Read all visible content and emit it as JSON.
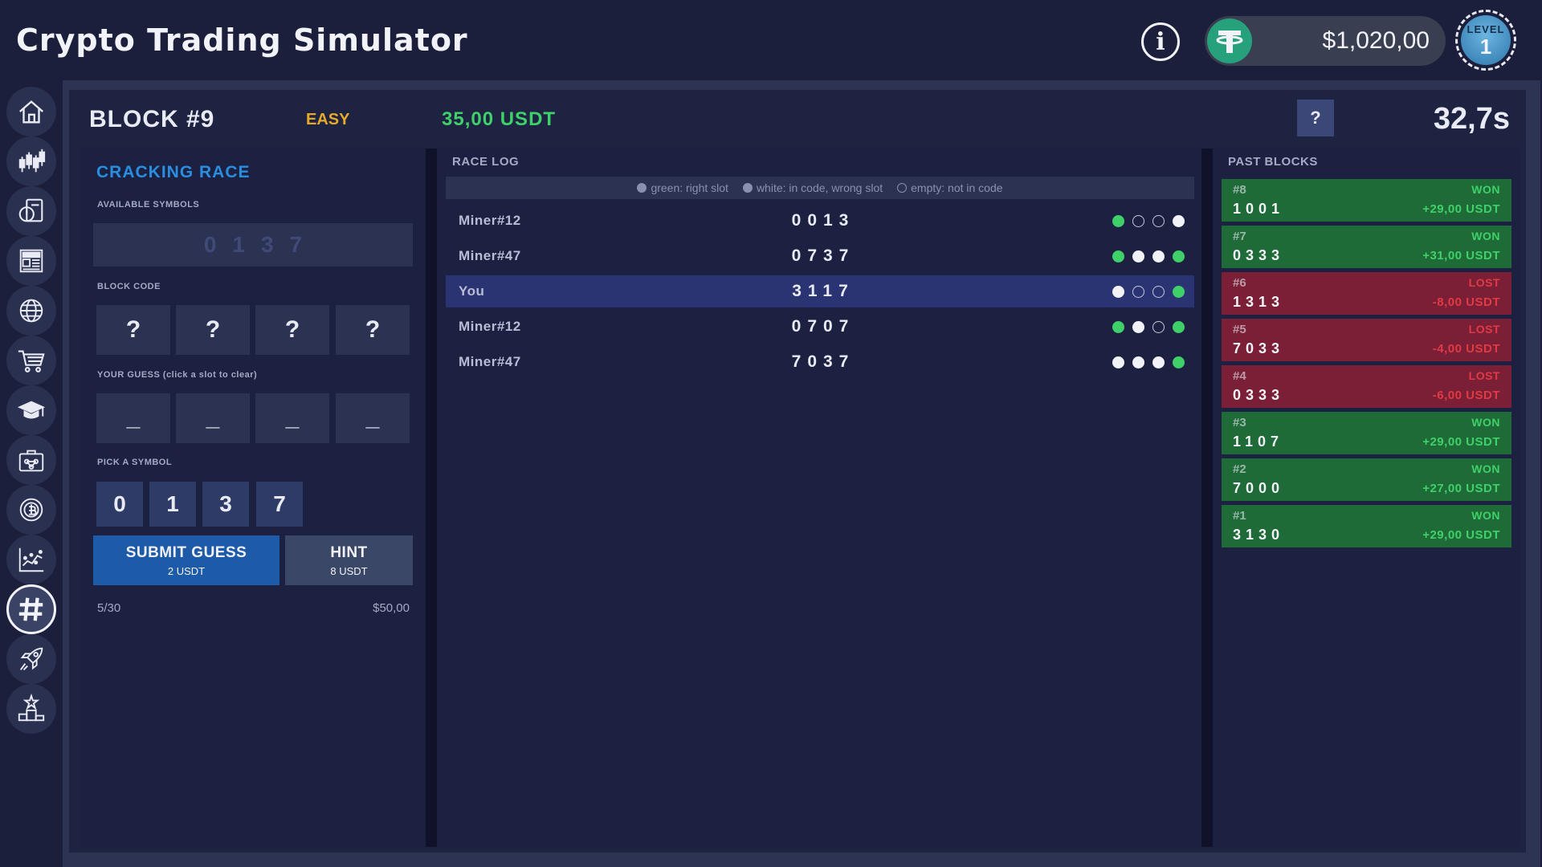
{
  "app": {
    "title": "Crypto Trading Simulator"
  },
  "header": {
    "info_label": "i",
    "balance": "$1,020,00",
    "level_label": "LEVEL",
    "level_number": "1"
  },
  "sidebar": {
    "items": [
      {
        "name": "home-icon"
      },
      {
        "name": "candlestick-chart-icon"
      },
      {
        "name": "stopwatch-document-icon"
      },
      {
        "name": "news-icon"
      },
      {
        "name": "globe-icon"
      },
      {
        "name": "cart-icon"
      },
      {
        "name": "graduation-cap-icon"
      },
      {
        "name": "briefcase-network-icon"
      },
      {
        "name": "coin-mining-icon"
      },
      {
        "name": "scatter-chart-icon"
      },
      {
        "name": "hash-icon"
      },
      {
        "name": "rocket-icon"
      },
      {
        "name": "podium-star-icon"
      }
    ],
    "active_index": 10
  },
  "block": {
    "title": "BLOCK #9",
    "difficulty": "EASY",
    "reward": "35,00 USDT",
    "help_label": "?",
    "timer": "32,7s"
  },
  "game": {
    "title": "CRACKING RACE",
    "available_label": "AVAILABLE SYMBOLS",
    "available_symbols": "0137",
    "block_code_label": "BLOCK CODE",
    "block_code": [
      "?",
      "?",
      "?",
      "?"
    ],
    "guess_label": "YOUR GUESS  (click a slot to clear)",
    "guess": [
      "_",
      "_",
      "_",
      "_"
    ],
    "pick_label": "PICK A SYMBOL",
    "symbols": [
      "0",
      "1",
      "3",
      "7"
    ],
    "submit_label": "SUBMIT GUESS",
    "submit_cost": "2 USDT",
    "hint_label": "HINT",
    "hint_cost": "8 USDT",
    "attempts": "5/30",
    "pot": "$50,00"
  },
  "race_log": {
    "title": "RACE LOG",
    "legend": [
      {
        "type": "filled",
        "text": "green: right slot"
      },
      {
        "type": "filled",
        "text": "white: in code, wrong slot"
      },
      {
        "type": "hollow",
        "text": "empty: not in code"
      }
    ],
    "rows": [
      {
        "player": "Miner#12",
        "guess": "0013",
        "pegs": [
          "green",
          "empty",
          "empty",
          "white"
        ],
        "me": false
      },
      {
        "player": "Miner#47",
        "guess": "0737",
        "pegs": [
          "green",
          "white",
          "white",
          "green"
        ],
        "me": false
      },
      {
        "player": "You",
        "guess": "3117",
        "pegs": [
          "white",
          "empty",
          "empty",
          "green"
        ],
        "me": true
      },
      {
        "player": "Miner#12",
        "guess": "0707",
        "pegs": [
          "green",
          "white",
          "empty",
          "green"
        ],
        "me": false
      },
      {
        "player": "Miner#47",
        "guess": "7037",
        "pegs": [
          "white",
          "white",
          "white",
          "green"
        ],
        "me": false
      }
    ]
  },
  "past_blocks": {
    "title": "PAST BLOCKS",
    "items": [
      {
        "id": "#8",
        "status": "WON",
        "code": "1001",
        "amount": "+29,00 USDT"
      },
      {
        "id": "#7",
        "status": "WON",
        "code": "0333",
        "amount": "+31,00 USDT"
      },
      {
        "id": "#6",
        "status": "LOST",
        "code": "1313",
        "amount": "-8,00 USDT"
      },
      {
        "id": "#5",
        "status": "LOST",
        "code": "7033",
        "amount": "-4,00 USDT"
      },
      {
        "id": "#4",
        "status": "LOST",
        "code": "0333",
        "amount": "-6,00 USDT"
      },
      {
        "id": "#3",
        "status": "WON",
        "code": "1107",
        "amount": "+29,00 USDT"
      },
      {
        "id": "#2",
        "status": "WON",
        "code": "7000",
        "amount": "+27,00 USDT"
      },
      {
        "id": "#1",
        "status": "WON",
        "code": "3130",
        "amount": "+29,00 USDT"
      }
    ]
  },
  "colors": {
    "accent_blue": "#2a8ee0",
    "win_green": "#3fd06a",
    "loss_red": "#e03a45",
    "easy_gold": "#e6a92a",
    "tether_green": "#26a17b"
  }
}
